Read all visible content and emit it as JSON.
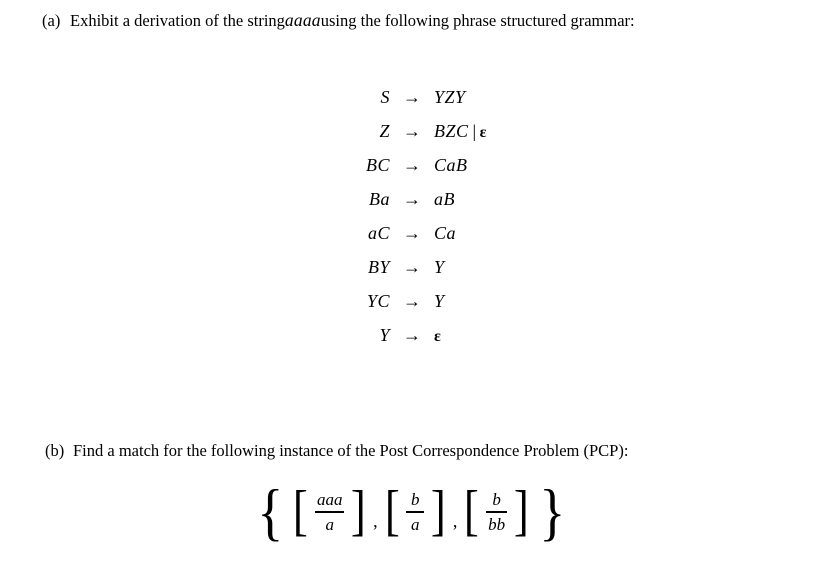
{
  "document": {
    "background_color": "#ffffff",
    "text_color": "#000000"
  },
  "parts": {
    "a": {
      "label": "(a)",
      "text_before": "Exhibit a derivation of the string ",
      "math_string": "aaaa",
      "text_after": " using the following phrase structured grammar:"
    },
    "b": {
      "label": "(b)",
      "text_before": "Find a match for the following instance of the Post Correspondence Problem (PCP):",
      "math_string": "",
      "text_after": ""
    }
  },
  "grammar": {
    "arrow": "→",
    "alternation_bar": "|",
    "epsilon": "ε",
    "rules": [
      {
        "lhs": "S",
        "arrow": "→",
        "rhs": "YZY",
        "alt": ""
      },
      {
        "lhs": "Z",
        "arrow": "→",
        "rhs": "BZC",
        "alt": "ε"
      },
      {
        "lhs": "BC",
        "arrow": "→",
        "rhs": "CaB",
        "alt": ""
      },
      {
        "lhs": "Ba",
        "arrow": "→",
        "rhs": "aB",
        "alt": ""
      },
      {
        "lhs": "aC",
        "arrow": "→",
        "rhs": "Ca",
        "alt": ""
      },
      {
        "lhs": "BY",
        "arrow": "→",
        "rhs": "Y",
        "alt": ""
      },
      {
        "lhs": "YC",
        "arrow": "→",
        "rhs": "Y",
        "alt": ""
      },
      {
        "lhs": "Y",
        "arrow": "→",
        "rhs": "ε",
        "alt": ""
      }
    ]
  },
  "pcp": {
    "open_brace": "{",
    "close_brace": "}",
    "open_bracket": "[",
    "close_bracket": "]",
    "separator": ",",
    "dominoes": [
      {
        "top": "aaa",
        "bottom": "a"
      },
      {
        "top": "b",
        "bottom": "a"
      },
      {
        "top": "b",
        "bottom": "bb"
      }
    ]
  }
}
